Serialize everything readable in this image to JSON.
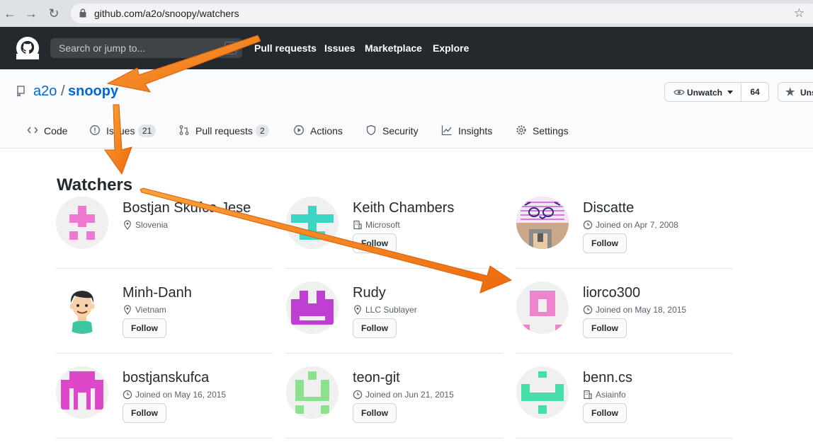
{
  "browser": {
    "url": "github.com/a2o/snoopy/watchers",
    "back_icon": "arrow-left-icon",
    "forward_icon": "arrow-right-icon",
    "reload_icon": "reload-icon"
  },
  "header": {
    "search_placeholder": "Search or jump to...",
    "search_shortcut": "/",
    "nav": [
      "Pull requests",
      "Issues",
      "Marketplace",
      "Explore"
    ]
  },
  "repo": {
    "owner": "a2o",
    "separator": "/",
    "name": "snoopy",
    "watch_label": "Unwatch",
    "watch_count": "64",
    "star_label": "Unstar"
  },
  "tabs": [
    {
      "label": "Code",
      "icon": "code-icon"
    },
    {
      "label": "Issues",
      "icon": "issue-icon",
      "count": "21"
    },
    {
      "label": "Pull requests",
      "icon": "pull-request-icon",
      "count": "2"
    },
    {
      "label": "Actions",
      "icon": "play-icon"
    },
    {
      "label": "Security",
      "icon": "shield-icon"
    },
    {
      "label": "Insights",
      "icon": "graph-icon"
    },
    {
      "label": "Settings",
      "icon": "gear-icon"
    }
  ],
  "page": {
    "title": "Watchers"
  },
  "watchers": [
    {
      "name": "Bostjan Skufca Jese",
      "meta": "Slovenia",
      "meta_icon": "location-icon",
      "follow": false
    },
    {
      "name": "Keith Chambers",
      "meta": "Microsoft",
      "meta_icon": "organization-icon",
      "follow": true
    },
    {
      "name": "Discatte",
      "meta": "Joined on Apr 7, 2008",
      "meta_icon": "clock-icon",
      "follow": true
    },
    {
      "name": "Minh-Danh",
      "meta": "Vietnam",
      "meta_icon": "location-icon",
      "follow": true
    },
    {
      "name": "Rudy",
      "meta": "LLC Sublayer",
      "meta_icon": "location-icon",
      "follow": true
    },
    {
      "name": "liorco300",
      "meta": "Joined on May 18, 2015",
      "meta_icon": "clock-icon",
      "follow": true
    },
    {
      "name": "bostjanskufca",
      "meta": "Joined on May 16, 2015",
      "meta_icon": "clock-icon",
      "follow": true
    },
    {
      "name": "teon-git",
      "meta": "Joined on Jun 21, 2015",
      "meta_icon": "clock-icon",
      "follow": true
    },
    {
      "name": "benn.cs",
      "meta": "Asiainfo",
      "meta_icon": "organization-icon",
      "follow": true
    }
  ],
  "follow_label": "Follow",
  "colors": {
    "header_bg": "#24292e",
    "link": "#0366d6",
    "annotation_arrow": "#f47b16"
  }
}
